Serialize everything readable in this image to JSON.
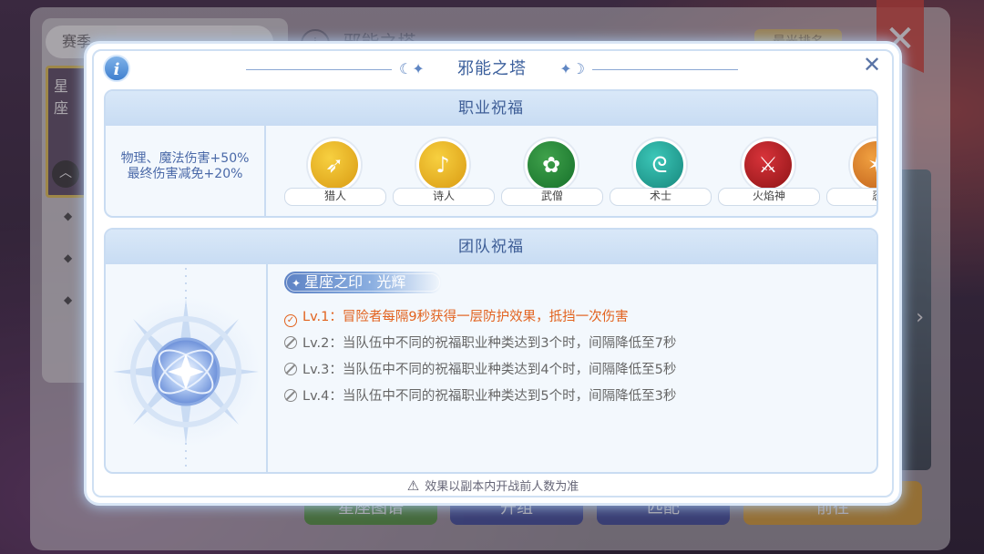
{
  "background": {
    "season_label": "赛季",
    "card_label": "星座",
    "title_bg": "邪能之塔",
    "rank_button": "最光排名",
    "close_glyph": "✕",
    "bottom_buttons": [
      "星座图谱",
      "开组",
      "匹配",
      "前往"
    ]
  },
  "modal": {
    "title": "邪能之塔",
    "info_glyph": "i",
    "close_glyph": "✕",
    "job_section": {
      "heading": "职业祝福",
      "desc_line1": "物理、魔法伤害+50%",
      "desc_line2": "最终伤害减免+20%",
      "jobs": [
        {
          "name": "猎人",
          "icon": "bow-icon",
          "color": "#e8b825"
        },
        {
          "name": "诗人",
          "icon": "lute-icon",
          "color": "#e8b825"
        },
        {
          "name": "武僧",
          "icon": "flower-icon",
          "color": "#1f8a35"
        },
        {
          "name": "术士",
          "icon": "swirl-icon",
          "color": "#22a89b"
        },
        {
          "name": "火焰神",
          "icon": "crossed-swords-icon",
          "color": "#b8202a"
        },
        {
          "name": "忍",
          "icon": "ninja-icon",
          "color": "#e0882a"
        }
      ]
    },
    "team_section": {
      "heading": "团队祝福",
      "badge": "星座之印 · 光辉",
      "levels": [
        {
          "text": "Lv.1：冒险者每隔9秒获得一层防护效果，抵挡一次伤害",
          "active": true
        },
        {
          "text": "Lv.2：当队伍中不同的祝福职业种类达到3个时，间隔降低至7秒",
          "active": false
        },
        {
          "text": "Lv.3：当队伍中不同的祝福职业种类达到4个时，间隔降低至5秒",
          "active": false
        },
        {
          "text": "Lv.4：当队伍中不同的祝福职业种类达到5个时，间隔降低至3秒",
          "active": false
        }
      ]
    },
    "footer_note": "效果以副本内开战前人数为准"
  }
}
